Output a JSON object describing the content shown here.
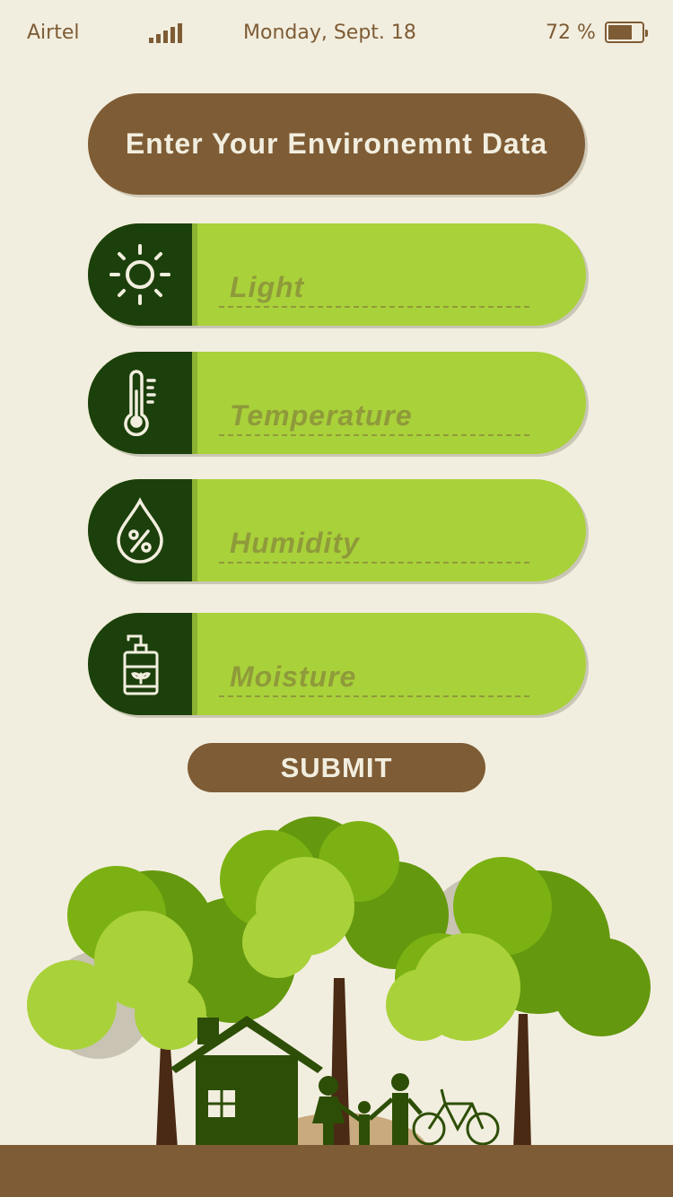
{
  "status_bar": {
    "carrier": "Airtel",
    "date": "Monday, Sept. 18",
    "battery": "72 %",
    "battery_level": 0.72,
    "signal_bars": 5
  },
  "header": {
    "title": "Enter Your Environemnt Data"
  },
  "fields": [
    {
      "icon": "sun-icon",
      "placeholder": "Light",
      "value": ""
    },
    {
      "icon": "thermometer-icon",
      "placeholder": "Temperature",
      "value": ""
    },
    {
      "icon": "humidity-drop-icon",
      "placeholder": "Humidity",
      "value": ""
    },
    {
      "icon": "soil-moisture-icon",
      "placeholder": "Moisture",
      "value": ""
    }
  ],
  "submit_label": "SUBMIT",
  "colors": {
    "brown": "#7e5c35",
    "dark_green": "#1c400b",
    "lime": "#a9d13a",
    "background": "#f2eedf"
  }
}
